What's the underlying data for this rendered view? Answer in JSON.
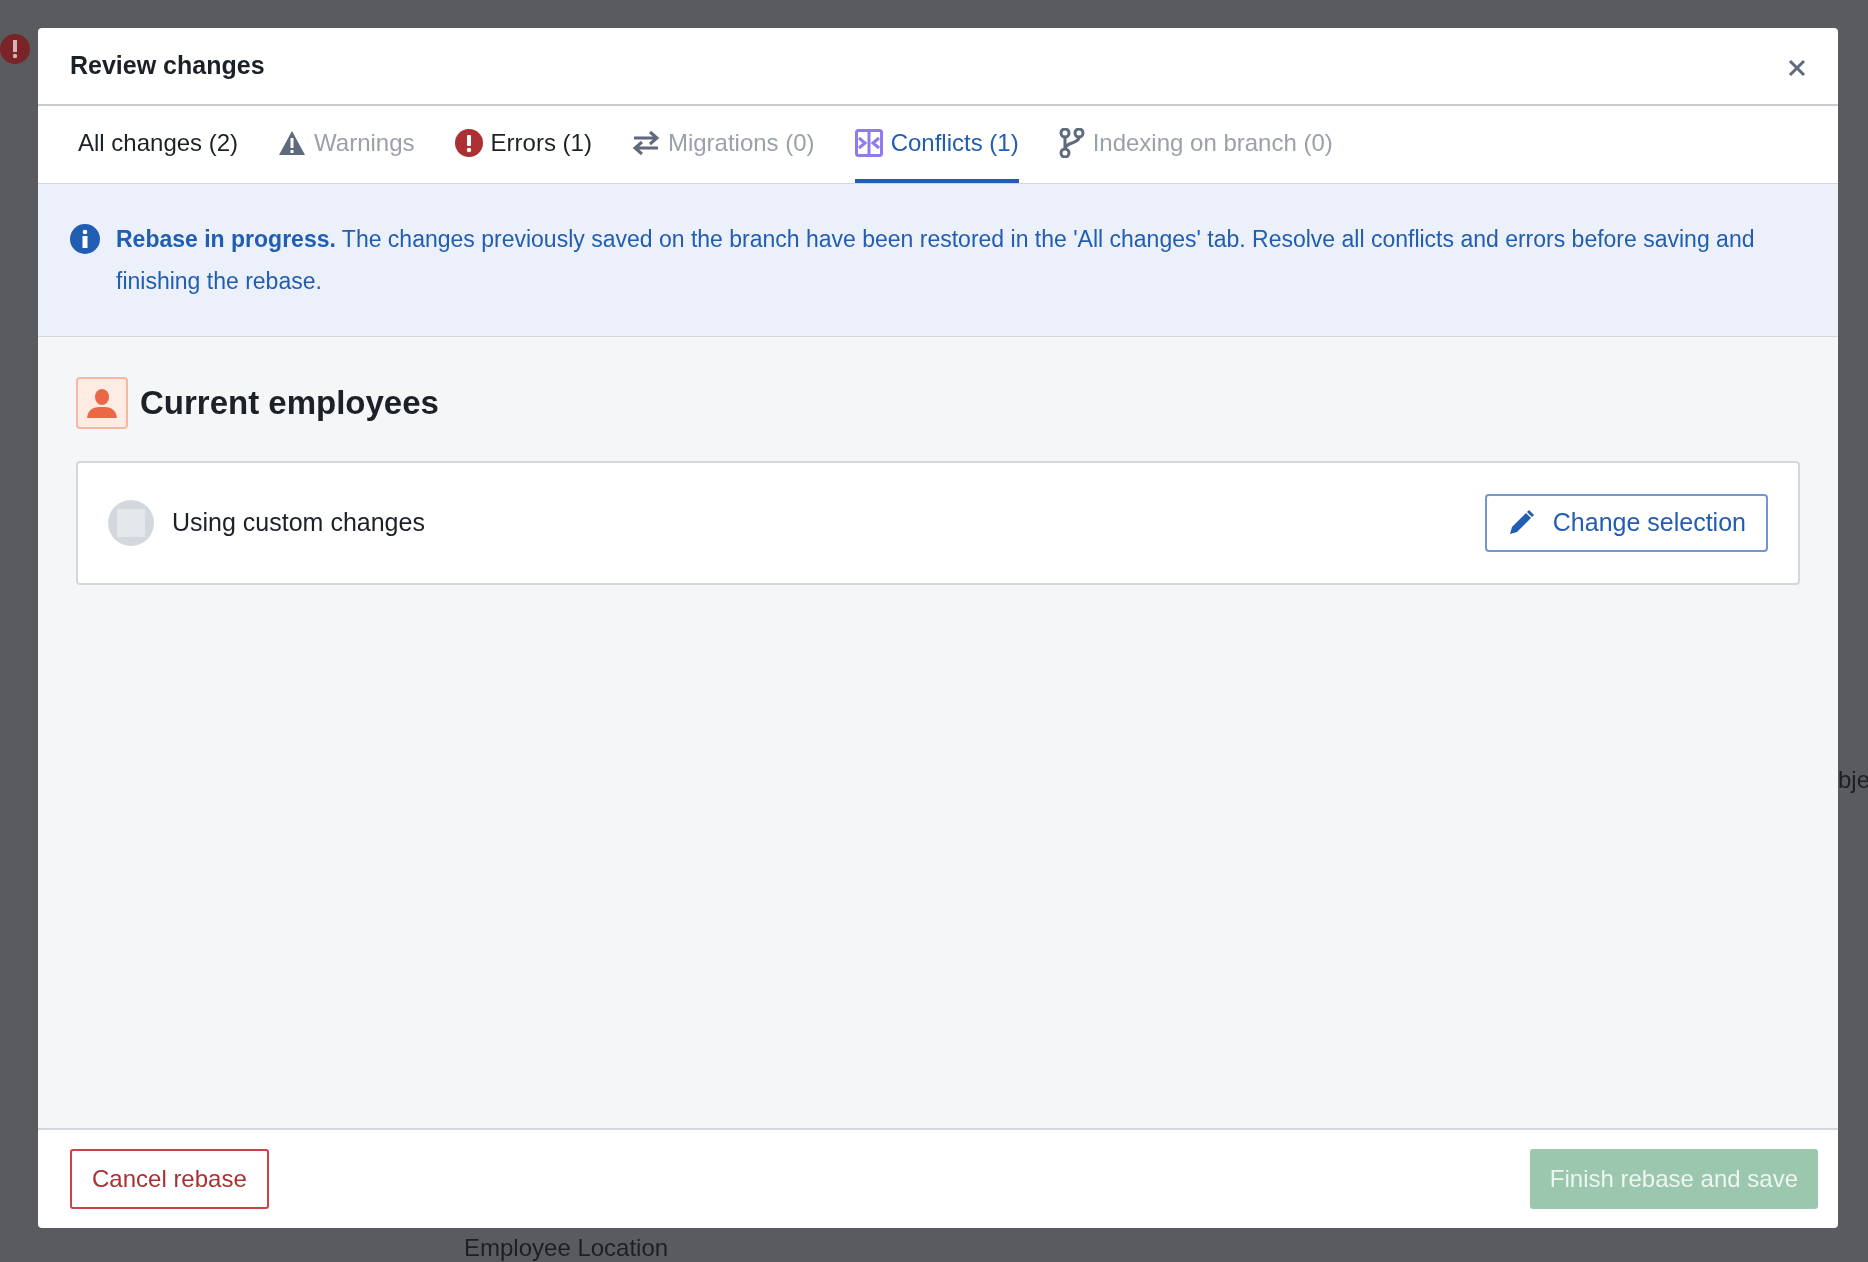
{
  "background": {
    "texts": [
      "Employee Location",
      "bje"
    ]
  },
  "dialog": {
    "title": "Review changes"
  },
  "tabs": [
    {
      "kind": "plain",
      "label": "All changes (2)",
      "selected": false,
      "disabled": false
    },
    {
      "kind": "warning",
      "label": "Warnings",
      "selected": false,
      "disabled": true
    },
    {
      "kind": "error",
      "label": "Errors (1)",
      "selected": false,
      "disabled": false
    },
    {
      "kind": "migration",
      "label": "Migrations (0)",
      "selected": false,
      "disabled": true
    },
    {
      "kind": "conflict",
      "label": "Conflicts (1)",
      "selected": true,
      "disabled": false
    },
    {
      "kind": "branch",
      "label": "Indexing on branch (0)",
      "selected": false,
      "disabled": true
    }
  ],
  "banner": {
    "text": "**Rebase in progress.** The changes previously saved on the branch have been restored in the 'All changes' tab. Resolve all conflicts and errors before saving and finishing the rebase."
  },
  "section": {
    "title": "Current employees",
    "status": "Using custom changes",
    "action": "Change selection"
  },
  "footer": {
    "cancel": "Cancel rebase",
    "finish": "Finish rebase and save",
    "finish_disabled": true
  }
}
